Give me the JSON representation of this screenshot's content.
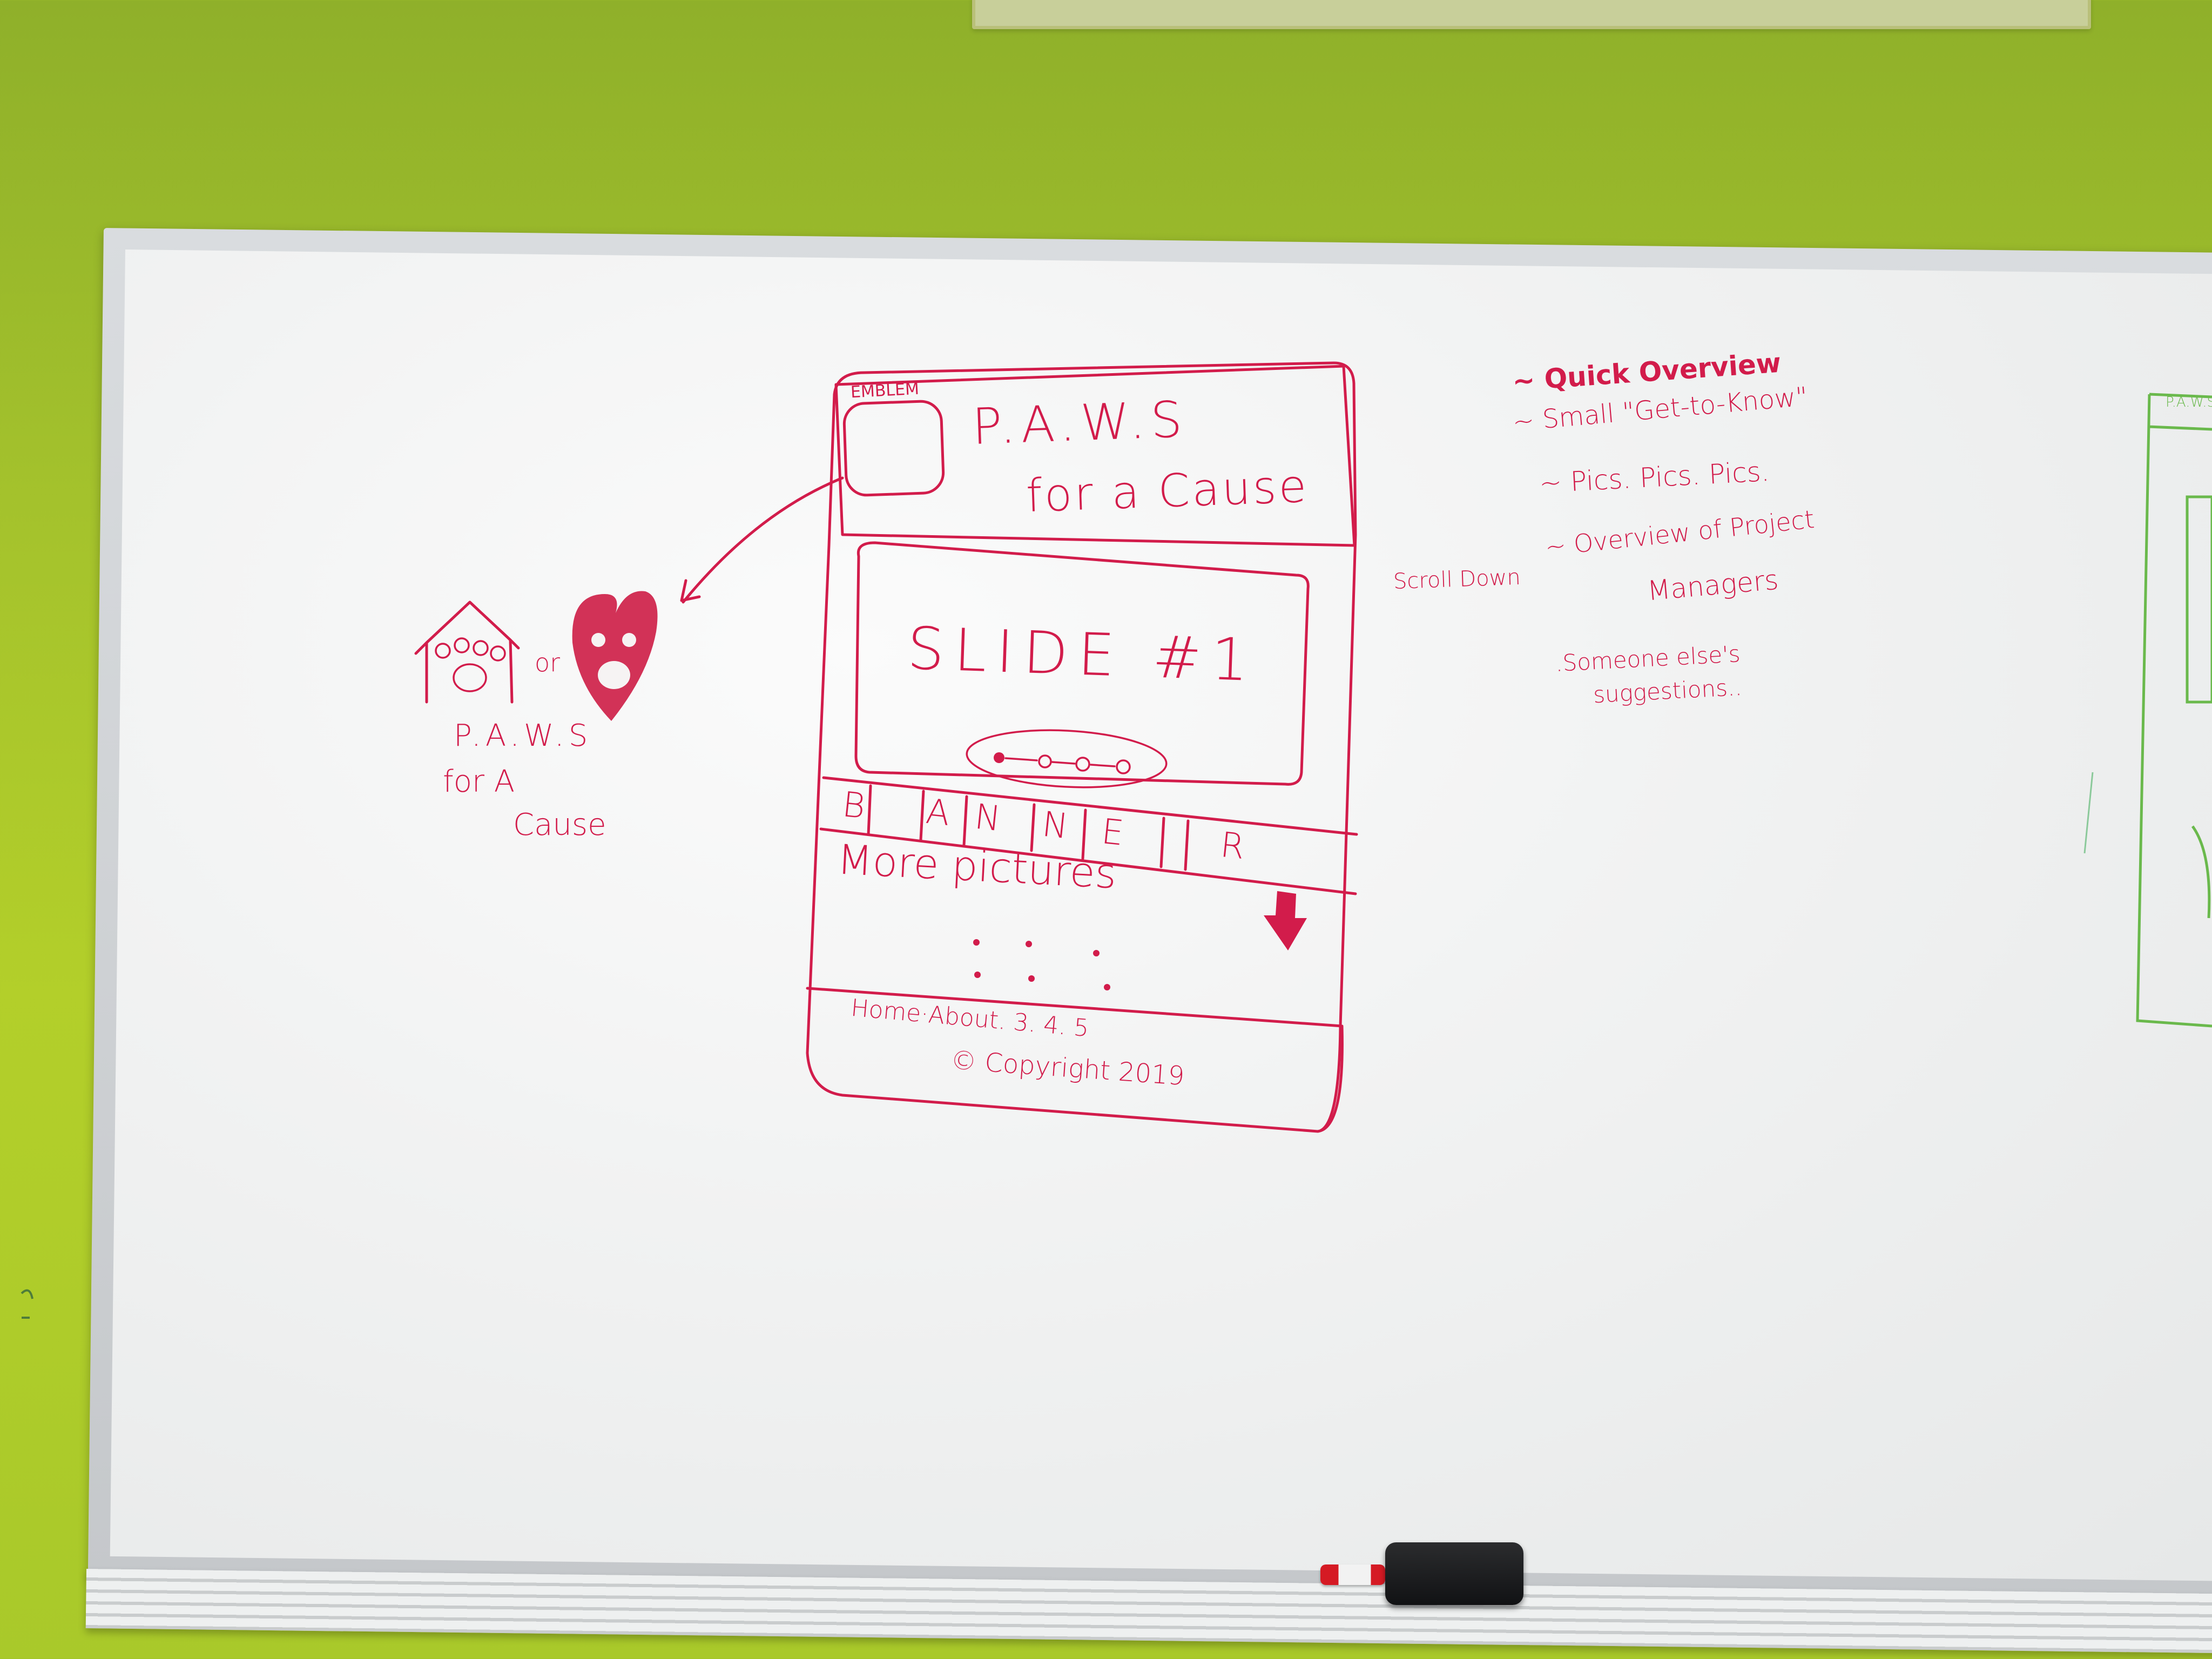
{
  "colors": {
    "wall": "#a4c22c",
    "board": "#f1f2f2",
    "marker_red": "#d21c4b",
    "marker_green": "#6ab94c"
  },
  "sketch": {
    "emblem_label": "EMBLEM",
    "title_line1": "P.A.W.S",
    "title_line2": "for a Cause",
    "slide_label": "SLIDE #1",
    "banner_letters": [
      "B",
      "A",
      "N",
      "N",
      "E",
      "R"
    ],
    "more_pictures": "More pictures",
    "footer_nav": "Home·About. 3. 4. 5",
    "footer_copyright": "© Copyright 2019"
  },
  "alternative_logo": {
    "or_text": "or",
    "name_line1": "P.A.W.S",
    "name_line2": "for A",
    "name_line3": "Cause"
  },
  "notes": {
    "item1": "~ Quick Overview",
    "item2": "~ Small \"Get-to-Know\"",
    "item3": "~ Pics. Pics. Pics.",
    "scroll_label": "Scroll Down",
    "item4a": "~ Overview of Project",
    "item4b": "Managers",
    "item5a": ".Someone else's",
    "item5b": "suggestions.."
  },
  "right_sketch": {
    "title": "P.A.W.S"
  }
}
